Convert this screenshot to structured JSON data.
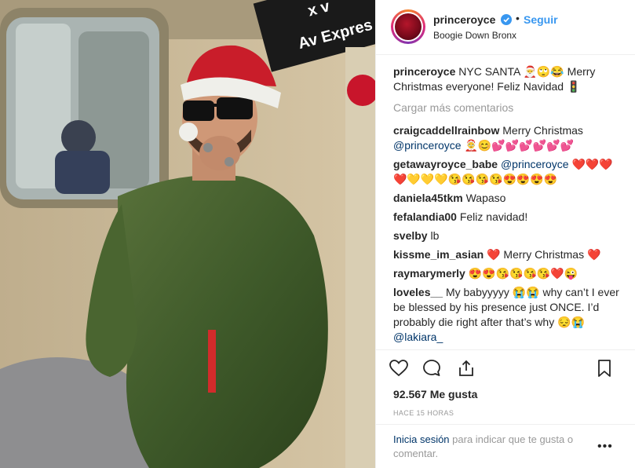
{
  "header": {
    "username": "princeroyce",
    "follow_dot": "•",
    "follow_label": "Seguir",
    "location": "Boogie Down Bronx"
  },
  "photo": {
    "sign_text_1": "x v",
    "sign_text_2": "Av Expres"
  },
  "caption": {
    "username": "princeroyce",
    "text": "NYC SANTA 🎅🙄😂 Merry Christmas everyone! Feliz Navidad 🚦"
  },
  "load_more": "Cargar más comentarios",
  "comments": [
    {
      "user": "craigcaddellrainbow",
      "text": "Merry Christmas",
      "mention": "@princeroyce",
      "after": "🤶😊💕💕💕💕💕💕"
    },
    {
      "user": "getawayroyce_babe",
      "text": "",
      "mention": "@princeroyce",
      "after": "❤️❤️❤️❤️💛💛💛😘😘😘😘😍😍😍😍"
    },
    {
      "user": "daniela45tkm",
      "text": "Wapaso",
      "mention": "",
      "after": ""
    },
    {
      "user": "fefalandia00",
      "text": "Feliz navidad!",
      "mention": "",
      "after": ""
    },
    {
      "user": "svelby",
      "text": "lb",
      "mention": "",
      "after": ""
    },
    {
      "user": "kissme_im_asian",
      "text": "❤️ Merry Christmas ❤️",
      "mention": "",
      "after": ""
    },
    {
      "user": "raymarymerly",
      "text": "😍😍😘😘😘😘❤️😜",
      "mention": "",
      "after": ""
    },
    {
      "user": "loveles__",
      "text": "My babyyyyy 😭😭 why can’t I ever be blessed by his presence just ONCE. I’d probably die right after that’s why 😔😭",
      "mention": "@lakiara_",
      "after": ""
    }
  ],
  "likes": "92.567 Me gusta",
  "timestamp": "HACE 15 HORAS",
  "login": {
    "link": "Inicia sesión",
    "rest": " para indicar que te gusta o comentar."
  },
  "options_icon": "ellipsis-icon",
  "colors": {
    "accent": "#3897f0",
    "link": "#003569",
    "muted": "#999999"
  }
}
